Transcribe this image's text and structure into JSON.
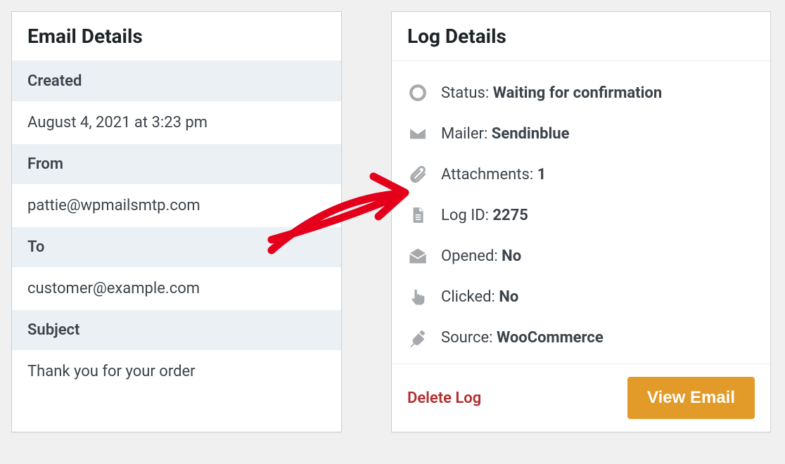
{
  "email_details": {
    "title": "Email Details",
    "created": {
      "label": "Created",
      "value": "August 4, 2021 at 3:23 pm"
    },
    "from": {
      "label": "From",
      "value": "pattie@wpmailsmtp.com"
    },
    "to": {
      "label": "To",
      "value": "customer@example.com"
    },
    "subject": {
      "label": "Subject",
      "value": "Thank you for your order"
    }
  },
  "log_details": {
    "title": "Log Details",
    "status": {
      "label": "Status: ",
      "value": "Waiting for confirmation"
    },
    "mailer": {
      "label": "Mailer: ",
      "value": "Sendinblue"
    },
    "attachments": {
      "label": "Attachments: ",
      "value": "1"
    },
    "log_id": {
      "label": "Log ID: ",
      "value": "2275"
    },
    "opened": {
      "label": "Opened: ",
      "value": "No"
    },
    "clicked": {
      "label": "Clicked: ",
      "value": "No"
    },
    "source": {
      "label": "Source: ",
      "value": "WooCommerce"
    }
  },
  "actions": {
    "delete": "Delete Log",
    "view": "View Email"
  }
}
